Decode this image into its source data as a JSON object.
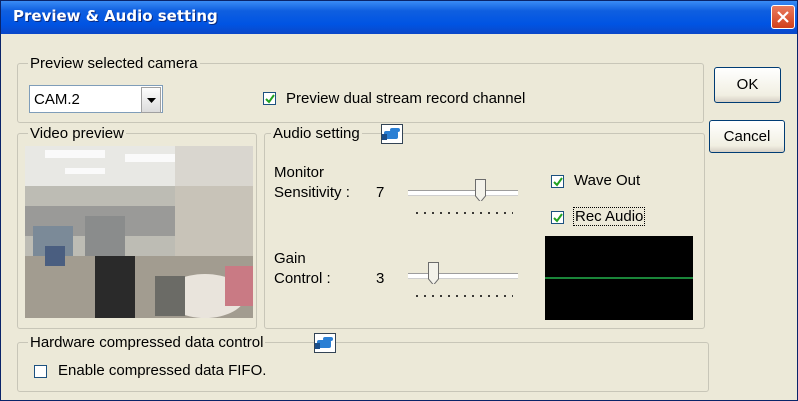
{
  "window": {
    "title": "Preview & Audio setting"
  },
  "buttons": {
    "ok": "OK",
    "cancel": "Cancel"
  },
  "preview_camera": {
    "legend": "Preview selected camera",
    "camera_value": "CAM.2",
    "dual_stream_label": "Preview dual stream record channel",
    "dual_stream_checked": true
  },
  "video_preview": {
    "legend": "Video preview"
  },
  "audio": {
    "legend": "Audio setting",
    "monitor_label_line1": "Monitor",
    "monitor_label_line2": "Sensitivity :",
    "monitor_value": "7",
    "gain_label_line1": "Gain",
    "gain_label_line2": "Control :",
    "gain_value": "3",
    "wave_out_label": "Wave Out",
    "wave_out_checked": true,
    "rec_audio_label": "Rec Audio",
    "rec_audio_checked": true,
    "scope_colors": {
      "background": "#000000",
      "line": "#22b14c"
    }
  },
  "hardware": {
    "legend": "Hardware compressed data control",
    "fifo_label": "Enable compressed data FIFO.",
    "fifo_checked": false
  },
  "colors": {
    "titlebar": "#0054e3",
    "dialog_bg": "#ece9d8",
    "close": "#d1401a"
  }
}
